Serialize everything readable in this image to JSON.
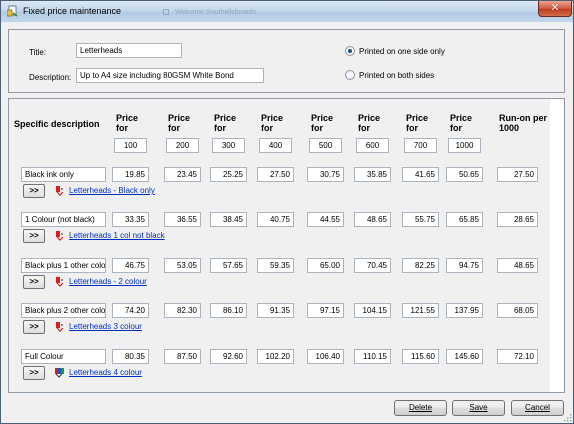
{
  "window": {
    "title": "Fixed price maintenance",
    "background_title": "Welcome Southallsboards"
  },
  "header": {
    "title_label": "Title:",
    "title_value": "Letterheads",
    "description_label": "Description:",
    "description_value": "Up to A4 size including 80GSM White Bond",
    "radio_one_side": "Printed on one side only",
    "radio_both_sides": "Printed on both sides",
    "selected_option": "Printed on one side only"
  },
  "grid": {
    "desc_header": "Specific description",
    "price_header_line1": "Price",
    "price_header_line2": "for",
    "runon_header_line1": "Run-on per",
    "runon_header_line2": "1000",
    "quantities": [
      "100",
      "200",
      "300",
      "400",
      "500",
      "600",
      "700",
      "1000"
    ],
    "more_button": ">>",
    "rows": [
      {
        "description": "Black ink only",
        "prices": [
          "19.85",
          "23.45",
          "25.25",
          "27.50",
          "30.75",
          "35.85",
          "41.65",
          "50.65"
        ],
        "runon": "27.50",
        "link": "Letterheads - Black only",
        "icon": "red-ink-icon"
      },
      {
        "description": "1 Colour (not black)",
        "prices": [
          "33.35",
          "36.55",
          "38.45",
          "40.75",
          "44.55",
          "48.65",
          "55.75",
          "65.85"
        ],
        "runon": "28.65",
        "link": "Letterheads 1 col not black",
        "icon": "red-ink-icon"
      },
      {
        "description": "Black plus 1 other colo",
        "prices": [
          "46.75",
          "53.05",
          "57.65",
          "59.35",
          "65.00",
          "70.45",
          "82.25",
          "94.75"
        ],
        "runon": "48.65",
        "link": "Letterheads - 2 colour",
        "icon": "red-ink-icon"
      },
      {
        "description": "Black plus 2 other colo",
        "prices": [
          "74.20",
          "82.30",
          "86.10",
          "91.35",
          "97.15",
          "104.15",
          "121.55",
          "137.95"
        ],
        "runon": "68.05",
        "link": "Letterheads 3 colour",
        "icon": "red-ink-icon"
      },
      {
        "description": "Full Colour",
        "prices": [
          "80.35",
          "87.50",
          "92.60",
          "102.20",
          "106.40",
          "110.15",
          "115.60",
          "145.60"
        ],
        "runon": "72.10",
        "link": "Letterheads 4 colour",
        "icon": "full-colour-icon"
      }
    ]
  },
  "footer": {
    "delete_label": "Delete",
    "save_label": "Save",
    "cancel_label": "Cancel"
  }
}
